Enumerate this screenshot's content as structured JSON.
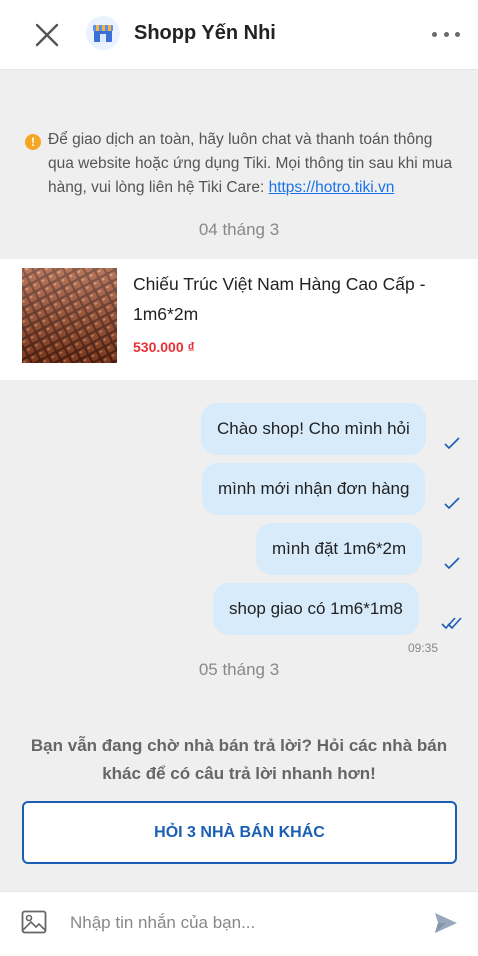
{
  "header": {
    "shop_name": "Shopp Yến Nhi",
    "close_icon": "close-icon",
    "more_icon": "more-options-icon"
  },
  "notice": {
    "text": "Để giao dịch an toàn, hãy luôn chat và thanh toán thông qua website hoặc ứng dụng Tiki. Mọi thông tin sau khi mua hàng, vui lòng liên hệ Tiki Care: ",
    "link": "https://hotro.tiki.vn",
    "icon": "!"
  },
  "dates": {
    "first": "04 tháng 3",
    "second": "05 tháng 3"
  },
  "product": {
    "title": "Chiếu Trúc Việt Nam Hàng Cao Cấp - 1m6*2m",
    "price": "530.000 ₫"
  },
  "messages": [
    {
      "text": "Chào shop! Cho mình hỏi",
      "status": "sent"
    },
    {
      "text": "mình mới nhận đơn hàng",
      "status": "sent"
    },
    {
      "text": "mình đặt 1m6*2m",
      "status": "sent"
    },
    {
      "text": "shop giao có 1m6*1m8",
      "status": "read"
    }
  ],
  "last_time": "09:35",
  "prompt": {
    "text": "Bạn vẫn đang chờ nhà bán trả lời? Hỏi các nhà bán khác để có câu trả lời nhanh hơn!",
    "button": "HỎI 3 NHÀ BÁN KHÁC"
  },
  "composer": {
    "placeholder": "Nhập tin nhắn của bạn..."
  },
  "colors": {
    "accent": "#1a5fb4",
    "bubble": "#d7ebfb",
    "price": "#e53238",
    "warning": "#f5a623"
  }
}
